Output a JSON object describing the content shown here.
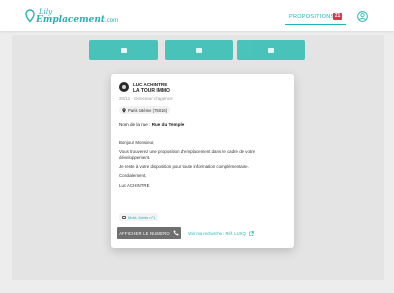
{
  "header": {
    "logo_small": "Lily",
    "logo_main": "Emplacement",
    "logo_tld": ".com",
    "nav_label": "PROPOSITIONS",
    "nav_badge": "21"
  },
  "card": {
    "sender_name": "LUC ACHINTRE",
    "agency_name": "LA TOUR IMMO",
    "meta": "20/11 · Directeur d'agence",
    "location": "Paris 16ème (75016)",
    "street_prefix": "Nom de la rue : ",
    "street_value": "Rue du Temple",
    "message": {
      "greeting": "Bonjour Monsieur,",
      "body1": "Vous trouverez une proposition d'emplacement dans le cadre de votre développement.",
      "body2": "Je reste à votre disposition pour toute information complémentaire.",
      "closing": "Cordialement,",
      "signature": "Luc ACHINTRE"
    },
    "more_link": "Mots Joints n°1",
    "phone_button": "AFFICHER LE NUMERO",
    "search_link": "Voir ma recherche : Réf. LUXQ"
  },
  "colors": {
    "accent": "#1fb5b5",
    "badge": "#e2334a",
    "button_gray": "#6f6f6f"
  }
}
